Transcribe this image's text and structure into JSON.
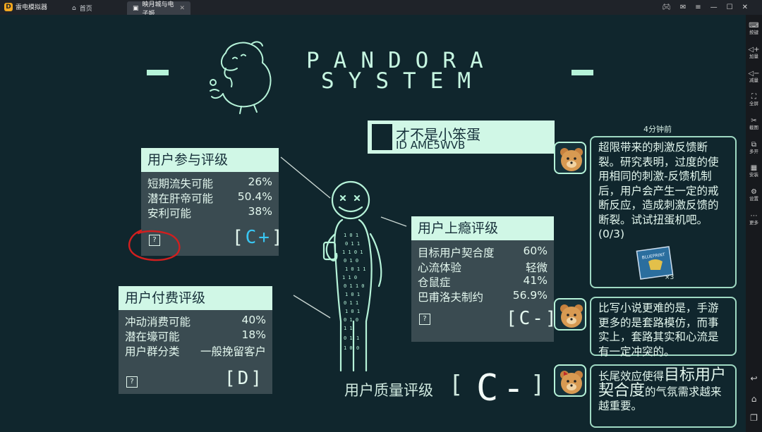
{
  "emulator": {
    "app_name": "雷电模拟器",
    "tabs": [
      {
        "label": "首页"
      },
      {
        "label": "映月城与电子姬"
      }
    ],
    "window_controls": [
      "gamepad-icon",
      "mail-icon",
      "menu-icon",
      "minimize-icon",
      "maximize-icon",
      "close-icon"
    ],
    "sidebar": [
      {
        "icon": "keyboard-icon",
        "label": "按键"
      },
      {
        "icon": "volume-up-icon",
        "label": "加量"
      },
      {
        "icon": "volume-down-icon",
        "label": "减量"
      },
      {
        "icon": "fullscreen-icon",
        "label": "全屏"
      },
      {
        "icon": "scissors-icon",
        "label": "截图"
      },
      {
        "icon": "multi-instance-icon",
        "label": "多开"
      },
      {
        "icon": "apk-install-icon",
        "label": "安装"
      },
      {
        "icon": "gear-icon",
        "label": "设置"
      },
      {
        "icon": "more-icon",
        "label": "更多"
      }
    ],
    "nav": [
      "back-icon",
      "home-icon",
      "recent-apps-icon"
    ]
  },
  "game": {
    "title_line1": "PANDORA",
    "title_line2": "SYSTEM",
    "user": {
      "name": "才不是小笨蛋",
      "id": "ID AME5WVB"
    },
    "panels": {
      "participation": {
        "title": "用户参与评级",
        "rows": [
          {
            "label": "短期流失可能",
            "value": "26%"
          },
          {
            "label": "潜在肝帝可能",
            "value": "50.4%"
          },
          {
            "label": "安利可能",
            "value": "38%"
          }
        ],
        "help": "?",
        "grade_open": "[",
        "grade": "C+",
        "grade_close": "]"
      },
      "payment": {
        "title": "用户付费评级",
        "rows": [
          {
            "label": "冲动消费可能",
            "value": "40%"
          },
          {
            "label": "潜在壕可能",
            "value": "18%"
          },
          {
            "label": "用户群分类",
            "value": "一般挽留客户"
          }
        ],
        "help": "?",
        "grade_open": "[",
        "grade": "D",
        "grade_close": "]"
      },
      "addiction": {
        "title": "用户上瘾评级",
        "rows": [
          {
            "label": "目标用户契合度",
            "value": "60%"
          },
          {
            "label": "心流体验",
            "value": "轻微"
          },
          {
            "label": "仓鼠症",
            "value": "41%"
          },
          {
            "label": "巴甫洛夫制约",
            "value": "56.9%"
          }
        ],
        "help": "?",
        "grade_open": "[",
        "grade": "C-",
        "grade_close": "]"
      }
    },
    "quality": {
      "label": "用户质量评级",
      "grade_open": "[",
      "grade": "C-",
      "grade_close": "]"
    },
    "feed": {
      "time_ago": "4分钟前",
      "messages": [
        {
          "text": "超限带来的刺激反馈断裂。研究表明，过度的使用相同的刺激-反馈机制后，用户会产生一定的戒断反应，造成刺激反馈的断裂。试试扭蛋机吧。(0/3)",
          "item_label": "BLUEPRINT",
          "item_count": "×3"
        },
        {
          "text": "比写小说更难的是，手游更多的是套路模仿，而事实上，套路其实和心流是有一定冲突的。"
        },
        {
          "text_pre": "长尾效应使得",
          "text_big": "目标用户契合度",
          "text_post": "的气氛需求越来越重要。"
        }
      ]
    }
  },
  "colors": {
    "background": "#10262d",
    "mint": "#b6f3d9",
    "accent_blue": "#39c6f2",
    "annotation_red": "#d21f1f"
  }
}
